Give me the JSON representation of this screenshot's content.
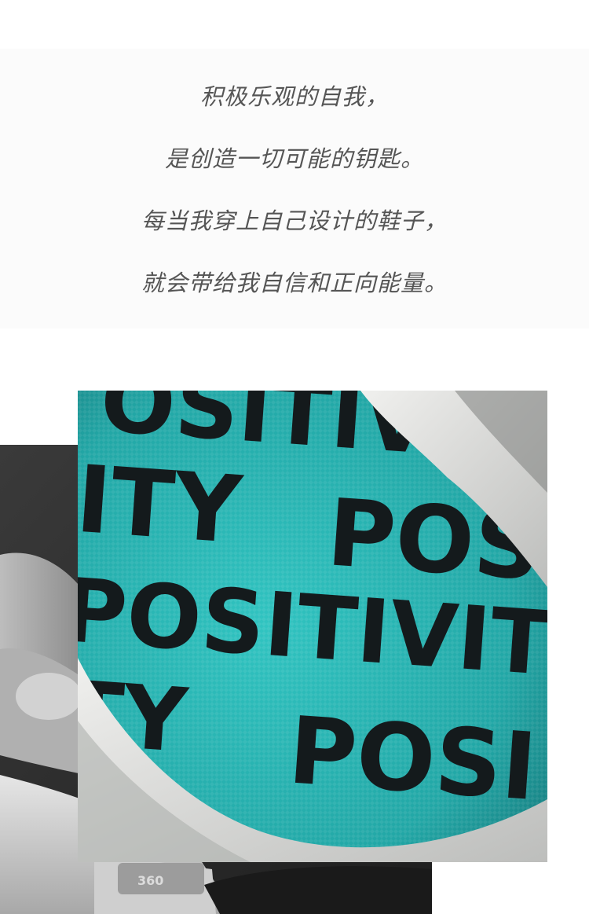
{
  "quote": {
    "lines": [
      "积极乐观的自我，",
      "是创造一切可能的钥匙。",
      "每当我穿上自己设计的鞋子，",
      "就会带给我自信和正向能量。"
    ]
  },
  "photos": {
    "back": {
      "subject": "hand holding white sneaker (grayscale)"
    },
    "front": {
      "subject": "teal shoe insole with repeated print",
      "print_text": [
        "OSITIV",
        "ITY",
        "POS",
        "POSITIVITY",
        "POSITIVITY",
        "TY",
        "POSI"
      ],
      "colors": {
        "insole": "#27b3b1",
        "print": "#141a1c",
        "shoe_upper": "#d9dad8"
      }
    }
  }
}
